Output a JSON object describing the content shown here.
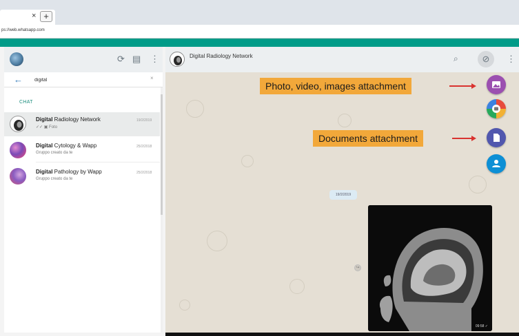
{
  "browser": {
    "tab_close": "×",
    "new_tab": "+",
    "bookmarks": [
      "",
      "",
      "",
      "",
      ""
    ],
    "url": "ps://web.whatsapp.com"
  },
  "left_header": {
    "icons": [
      "status-icon",
      "new-chat-icon",
      "menu-icon"
    ],
    "status_glyph": "⟳",
    "chat_glyph": "▤",
    "menu_glyph": "⋮"
  },
  "search": {
    "back_glyph": "←",
    "value": "digital",
    "clear_glyph": "×"
  },
  "list": {
    "section_label": "CHAT",
    "chats": [
      {
        "name_bold": "Digital",
        "name_rest": " Radiology Network",
        "sub": "✓✓ ▣ Foto",
        "date": "19/2/2019"
      },
      {
        "name_bold": "Digital",
        "name_rest": " Cytology & Wapp",
        "sub": "Gruppo creato da te",
        "date": "25/2/2018"
      },
      {
        "name_bold": "Digital",
        "name_rest": " Pathology by Wapp",
        "sub": "Gruppo creato da te",
        "date": "25/2/2018"
      }
    ]
  },
  "conversation": {
    "title": "Digital Radiology Network",
    "search_glyph": "⌕",
    "clip_glyph": "⊘",
    "menu_glyph": "⋮",
    "date_chip": "19/2/2019",
    "image_time": "09:58 ✓",
    "forward_glyph": "↪"
  },
  "annotations": {
    "photo_label": "Photo, video, images attachment",
    "docs_label": "Documents attachment"
  },
  "attachments": [
    {
      "name": "gallery-icon",
      "color": "#9b4fb0"
    },
    {
      "name": "camera-icon",
      "color": "#e74b3c"
    },
    {
      "name": "document-icon",
      "color": "#5157ae"
    },
    {
      "name": "contact-icon",
      "color": "#0d8fd5"
    }
  ],
  "colors": {
    "teal": "#009b88",
    "callout": "#f2a83a",
    "arrow": "#d9322f"
  }
}
